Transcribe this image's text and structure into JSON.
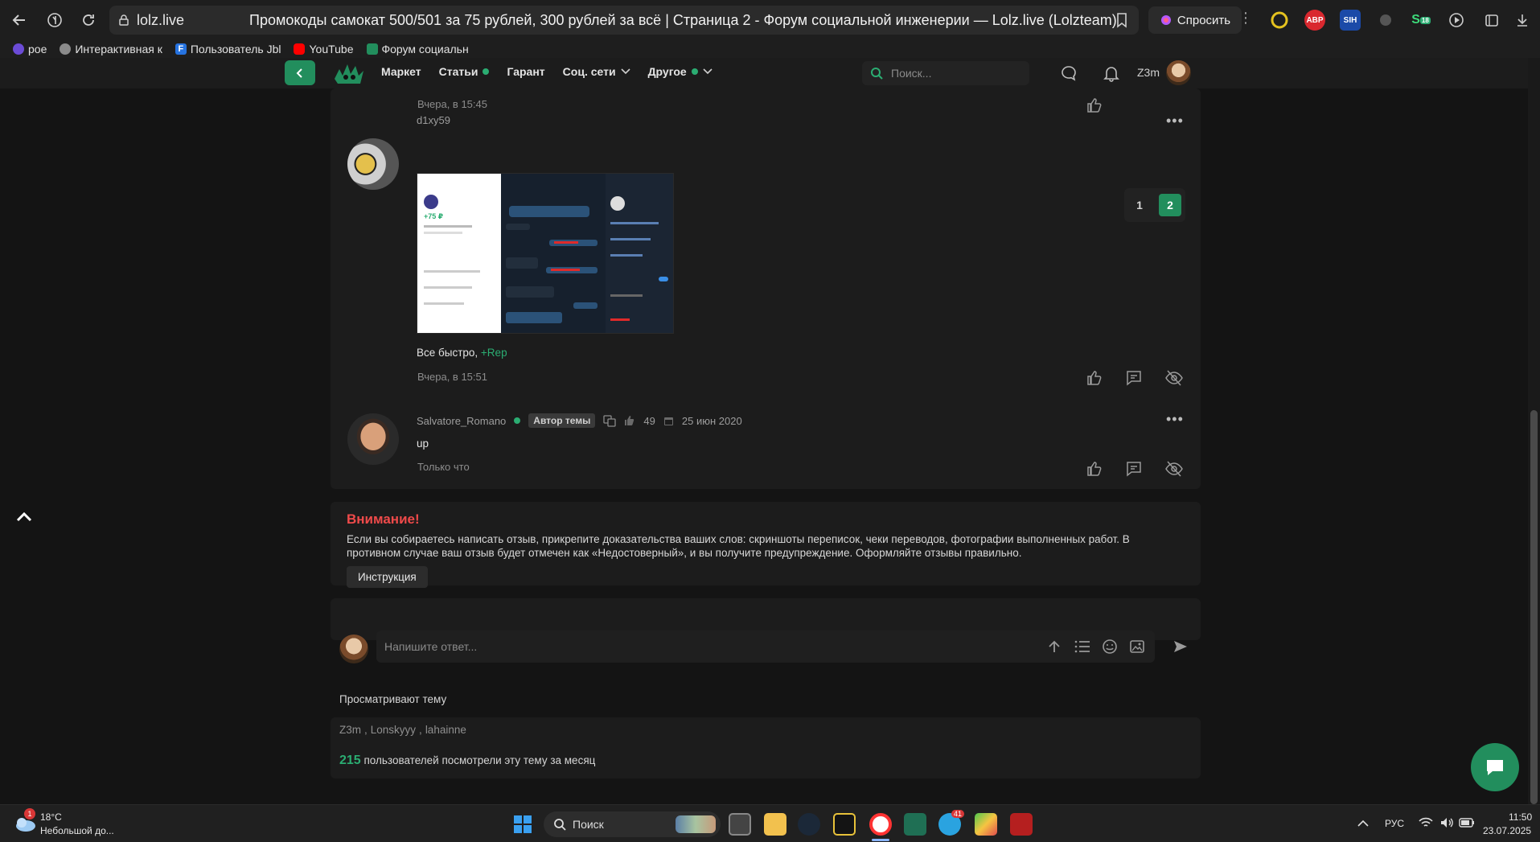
{
  "browser": {
    "url_domain": "lolz.live",
    "page_title": "Промокоды самокат 500/501 за 75 рублей, 300 рублей за всё | Страница 2 - Форум социальной инженерии — Lolz.live (Lolzteam)",
    "ask_label": "Спросить",
    "ext_abp": "ABP",
    "ext_sih": "SIH",
    "ext_badge": "18"
  },
  "bookmarks": [
    "poe",
    "Интерактивная к",
    "Пользователь Jbl",
    "YouTube",
    "Форум социальн"
  ],
  "header": {
    "menu": [
      {
        "label": "Маркет",
        "dot": false,
        "chevron": false
      },
      {
        "label": "Статьи",
        "dot": true,
        "chevron": false
      },
      {
        "label": "Гарант",
        "dot": false,
        "chevron": false
      },
      {
        "label": "Соц. сети",
        "dot": false,
        "chevron": true
      },
      {
        "label": "Другое",
        "dot": true,
        "chevron": true
      }
    ],
    "search_placeholder": "Поиск...",
    "username": "Z3m"
  },
  "pager": {
    "pages": [
      "1",
      "2"
    ],
    "current": "2"
  },
  "posts": {
    "prev_time": "Вчера, в 15:45",
    "p1": {
      "author": "d1xy59",
      "text": "Все быстро,",
      "rep": "+Rep",
      "time": "Вчера, в 15:51",
      "screenshot": {
        "amount": "+75 ₽"
      }
    },
    "p2": {
      "author": "Salvatore_Romano",
      "badge": "Автор темы",
      "likes": "49",
      "joined": "25 июн 2020",
      "text": "up",
      "time": "Только что"
    }
  },
  "warning": {
    "title": "Внимание!",
    "line1": "Если вы собираетесь написать отзыв, прикрепите доказательства ваших слов: скриншоты переписок, чеки переводов, фотографии выполненных работ. В",
    "line2": "противном случае ваш отзыв будет отмечен как «Недостоверный», и вы получите предупреждение. Оформляйте отзывы правильно.",
    "button": "Инструкция"
  },
  "reply": {
    "placeholder": "Напишите ответ..."
  },
  "viewers": {
    "title": "Просматривают тему",
    "names": [
      "Z3m",
      "Lonskyyy",
      "lahainne"
    ],
    "count": "215",
    "count_text": "пользователей посмотрели эту тему за месяц"
  },
  "taskbar": {
    "weather_temp": "18°C",
    "weather_desc": "Небольшой до...",
    "weather_badge": "1",
    "search_label": "Поиск",
    "tg_badge": "41",
    "lang": "РУС",
    "time": "11:50",
    "date": "23.07.2025"
  },
  "colors": {
    "accent": "#228e5d",
    "warning": "#ef4a4a",
    "rep": "#2bad72"
  }
}
